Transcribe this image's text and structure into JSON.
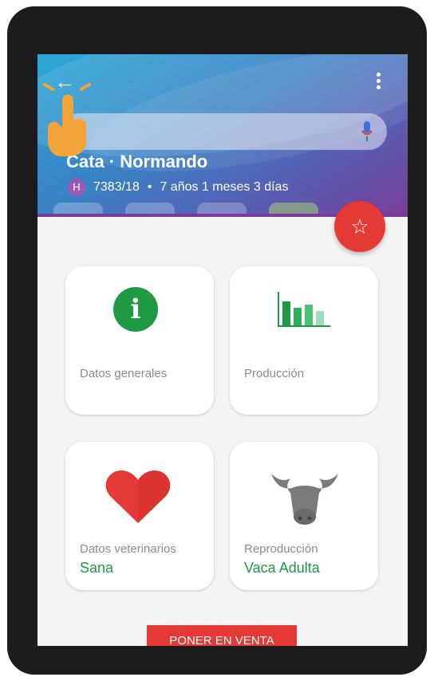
{
  "header": {
    "animal_name": "Cata · Normando",
    "badge_letter": "H",
    "id_number": "7383/18",
    "separator": "•",
    "age": "7 años 1 meses 3 días"
  },
  "cards": {
    "datos_generales": {
      "title": "Datos generales"
    },
    "produccion": {
      "title": "Producción"
    },
    "datos_veterinarios": {
      "title": "Datos veterinarios",
      "value": "Sana"
    },
    "reproduccion": {
      "title": "Reproducción",
      "value": "Vaca Adulta"
    }
  },
  "actions": {
    "sell_label": "PONER EN VENTA"
  },
  "colors": {
    "accent_red": "#e53935",
    "accent_green": "#1e9a45",
    "badge_purple": "#9b59b6"
  },
  "icons": {
    "back": "back-arrow-icon",
    "menu": "more-vert-icon",
    "mic": "mic-icon",
    "fab": "star-outline-icon",
    "info": "info-icon",
    "produccion": "bar-chart-icon",
    "veterinarios": "heart-icon",
    "reproduccion": "cow-icon"
  }
}
